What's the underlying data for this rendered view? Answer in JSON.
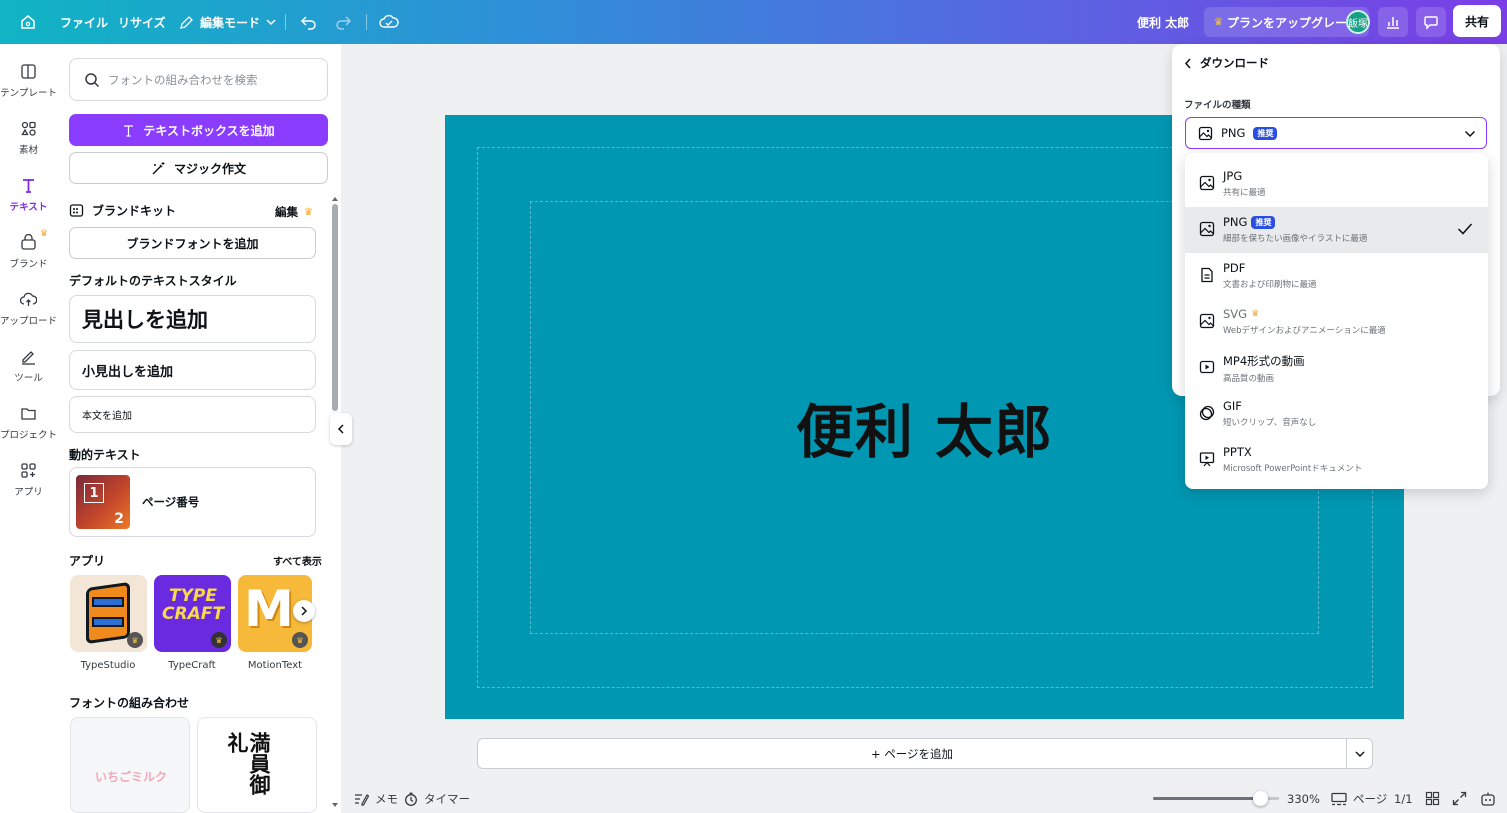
{
  "topbar": {
    "file": "ファイル",
    "resize": "リサイズ",
    "edit_mode": "編集モード",
    "project_name": "便利 太郎",
    "upgrade": "プランをアップグレード",
    "avatar_initials": "飯塚",
    "share": "共有"
  },
  "rail": {
    "items": [
      {
        "label": "テンプレート",
        "icon": "template-icon"
      },
      {
        "label": "素材",
        "icon": "elements-icon"
      },
      {
        "label": "テキスト",
        "icon": "text-icon"
      },
      {
        "label": "ブランド",
        "icon": "brand-icon"
      },
      {
        "label": "アップロード",
        "icon": "upload-icon"
      },
      {
        "label": "ツール",
        "icon": "draw-icon"
      },
      {
        "label": "プロジェクト",
        "icon": "folder-icon"
      },
      {
        "label": "アプリ",
        "icon": "apps-icon"
      }
    ]
  },
  "panel": {
    "search_placeholder": "フォントの組み合わせを検索",
    "add_textbox": "テキストボックスを追加",
    "magic_write": "マジック作文",
    "brand_kit": "ブランドキット",
    "brand_edit": "編集",
    "add_brand_font": "ブランドフォントを追加",
    "default_styles": "デフォルトのテキストスタイル",
    "heading": "見出しを追加",
    "subheading": "小見出しを追加",
    "body": "本文を追加",
    "dynamic_text": "動的テキスト",
    "page_number": "ページ番号",
    "page_thumb_num1": "1",
    "page_thumb_num2": "2",
    "apps_title": "アプリ",
    "see_all": "すべて表示",
    "apps": [
      {
        "name": "TypeStudio"
      },
      {
        "name": "TypeCraft"
      },
      {
        "name": "MotionText"
      }
    ],
    "typecraft_art": "TYPE CRAFT",
    "font_combos": "フォントの組み合わせ",
    "combo1": "いちごミルク",
    "combo2": "満員御礼"
  },
  "canvas": {
    "title": "便利 太郎",
    "add_page": "+ ページを追加",
    "bg_color": "#0097b2"
  },
  "bottombar": {
    "notes": "メモ",
    "timer": "タイマー",
    "zoom": "330%",
    "zoom_level": 0.85,
    "pages_label": "ページ",
    "page_count": "1/1"
  },
  "download": {
    "title": "ダウンロード",
    "file_type_label": "ファイルの種類",
    "selected": "PNG",
    "selected_badge": "推奨",
    "options": [
      {
        "name": "JPG",
        "desc": "共有に最適",
        "icon": "image-icon"
      },
      {
        "name": "PNG",
        "badge": "推奨",
        "desc": "細部を保ちたい画像やイラストに最適",
        "icon": "image-icon"
      },
      {
        "name": "PDF",
        "desc": "文書および印刷物に最適",
        "icon": "document-icon"
      },
      {
        "name": "SVG",
        "desc": "Webデザインおよびアニメーションに最適",
        "icon": "image-icon"
      },
      {
        "name": "MP4形式の動画",
        "desc": "高品質の動画",
        "icon": "video-icon"
      },
      {
        "name": "GIF",
        "desc": "短いクリップ、音声なし",
        "icon": "gif-icon"
      },
      {
        "name": "PPTX",
        "desc": "Microsoft PowerPointドキュメント",
        "icon": "presentation-icon"
      }
    ]
  },
  "colors": {
    "accent": "#8b3dff",
    "crown": "#f5a623",
    "badge": "#2a4fe0"
  }
}
